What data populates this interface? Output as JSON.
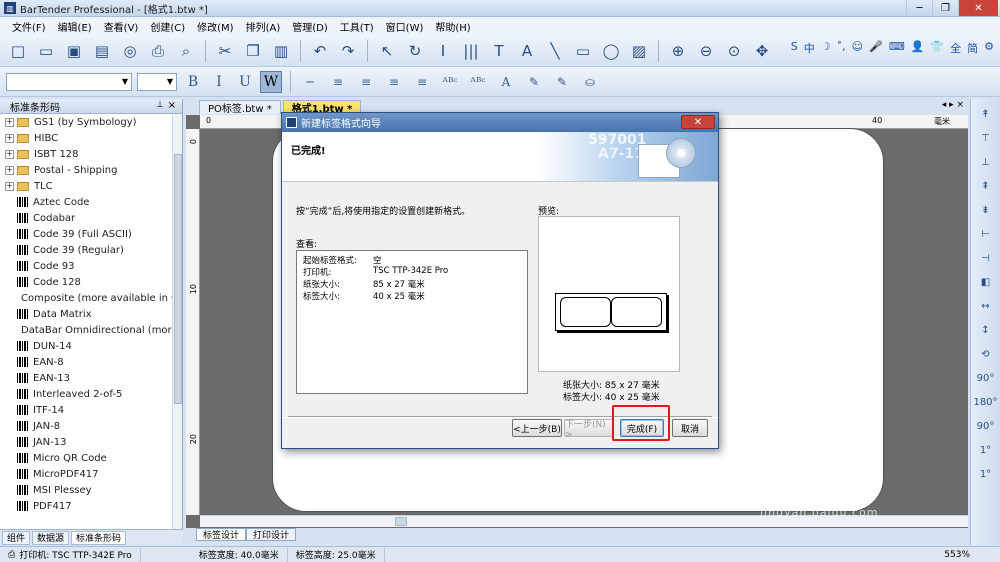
{
  "window": {
    "title": "BarTender Professional - [格式1.btw *]",
    "app_icon": "bartender-logo-icon"
  },
  "menu": [
    "文件(F)",
    "编辑(E)",
    "查看(V)",
    "创建(C)",
    "修改(M)",
    "排列(A)",
    "管理(D)",
    "工具(T)",
    "窗口(W)",
    "帮助(H)"
  ],
  "toolbar1_icons": [
    "new-icon",
    "open-icon",
    "save-icon",
    "print-setup-icon",
    "database-icon",
    "print-icon",
    "print-preview-icon",
    "cut-icon",
    "copy-icon",
    "paste-icon",
    "undo-icon",
    "redo-icon",
    "select-arrow-icon",
    "rotate-icon",
    "text-cursor-icon",
    "barcode-icon",
    "text-icon",
    "rich-text-icon",
    "line-icon",
    "rectangle-icon",
    "ellipse-icon",
    "picture-icon",
    "zoom-in-icon",
    "zoom-out-icon",
    "zoom-fit-icon",
    "zoom-page-icon"
  ],
  "toolbar1_glyphs": [
    "□",
    "▭",
    "▣",
    "▤",
    "◎",
    "⎙",
    "⌕",
    "✂",
    "❐",
    "▥",
    "↶",
    "↷",
    "↖",
    "↻",
    "I",
    "|||",
    "T",
    "A",
    "╲",
    "▭",
    "◯",
    "▨",
    "⊕",
    "⊖",
    "⊙",
    "✥"
  ],
  "ime_bar": [
    "S",
    "中",
    "☽",
    "˚,",
    "☺",
    "🎤",
    "⌨",
    "👤",
    "👕",
    "全",
    "简",
    "⚙"
  ],
  "toolbar2": {
    "format_buttons": [
      "B",
      "I",
      "U",
      "W"
    ],
    "align_glyphs": [
      "─",
      "≡",
      "≡",
      "≡",
      "≡",
      "ᴬᴮᶜ",
      "ᴬᴮᶜ",
      "A",
      "✎",
      "✎",
      "⛀"
    ]
  },
  "side_panel": {
    "title": "标准条形码",
    "items": [
      {
        "label": "GS1 (by Symbology)",
        "type": "folder"
      },
      {
        "label": "HIBC",
        "type": "folder"
      },
      {
        "label": "ISBT 128",
        "type": "folder"
      },
      {
        "label": "Postal - Shipping",
        "type": "folder"
      },
      {
        "label": "TLC",
        "type": "folder"
      },
      {
        "label": "Aztec Code",
        "type": "barcode"
      },
      {
        "label": "Codabar",
        "type": "barcode"
      },
      {
        "label": "Code 39 (Full ASCII)",
        "type": "barcode"
      },
      {
        "label": "Code 39 (Regular)",
        "type": "barcode"
      },
      {
        "label": "Code 93",
        "type": "barcode"
      },
      {
        "label": "Code 128",
        "type": "barcode"
      },
      {
        "label": "Composite (more available in GS",
        "type": "barcode"
      },
      {
        "label": "Data Matrix",
        "type": "barcode"
      },
      {
        "label": "DataBar Omnidirectional (more a",
        "type": "barcode"
      },
      {
        "label": "DUN-14",
        "type": "barcode"
      },
      {
        "label": "EAN-8",
        "type": "barcode"
      },
      {
        "label": "EAN-13",
        "type": "barcode"
      },
      {
        "label": "Interleaved 2-of-5",
        "type": "barcode"
      },
      {
        "label": "ITF-14",
        "type": "barcode"
      },
      {
        "label": "JAN-8",
        "type": "barcode"
      },
      {
        "label": "JAN-13",
        "type": "barcode"
      },
      {
        "label": "Micro QR Code",
        "type": "barcode"
      },
      {
        "label": "MicroPDF417",
        "type": "barcode"
      },
      {
        "label": "MSI Plessey",
        "type": "barcode"
      },
      {
        "label": "PDF417",
        "type": "barcode"
      }
    ],
    "tabs": [
      "组件",
      "数据源",
      "标准条形码"
    ]
  },
  "doc_tabs": [
    "PO标签.btw *",
    "格式1.btw *"
  ],
  "doc_tab_controls": "◂ ▸ ×",
  "ruler": {
    "top_labels": [
      "0",
      "40"
    ],
    "unit": "毫米",
    "left_labels": [
      "0",
      "10",
      "20"
    ]
  },
  "work_tabs": [
    "标签设计",
    "打印设计"
  ],
  "right_toolbar_icons": [
    "↟",
    "⊤",
    "⊥",
    "⇞",
    "⇟",
    "⊢",
    "⊣",
    "◧",
    "↔",
    "↕",
    "⟲",
    "90°",
    "180°",
    "90°",
    "1°",
    "1°"
  ],
  "statusbar": {
    "printer": "打印机: TSC TTP-342E Pro",
    "label_width": "标签宽度: 40.0毫米",
    "label_height": "标签高度: 25.0毫米",
    "zoom": "553%"
  },
  "dialog": {
    "title": "新建标签格式向导",
    "heading": "已完成!",
    "header_art": {
      "num1": "597001",
      "num2": "A7-11"
    },
    "intro": "按“完成”后,将使用指定的设置创建新格式。",
    "review_label": "查看:",
    "review": [
      {
        "key": "起始标签格式:",
        "value": "空"
      },
      {
        "key": "打印机:",
        "value": "TSC TTP-342E Pro"
      },
      {
        "key": "纸张大小:",
        "value": "85 x 27 毫米"
      },
      {
        "key": "标签大小:",
        "value": "40 x 25 毫米"
      }
    ],
    "preview_label": "预览:",
    "preview_info": {
      "paper": "纸张大小: 85 x 27 毫米",
      "label": "标签大小: 40 x 25 毫米"
    },
    "buttons": {
      "back": "<上一步(B)",
      "next": "下一步(N) >",
      "finish": "完成(F)",
      "cancel": "取消"
    },
    "close_glyph": "✕"
  },
  "watermark": {
    "main": "Bai经验",
    "sub": "jingyan.baidu.com"
  },
  "colors": {
    "highlight": "#e01818",
    "active_tab": "#f7e36d",
    "title_blue": "#4673ae"
  }
}
